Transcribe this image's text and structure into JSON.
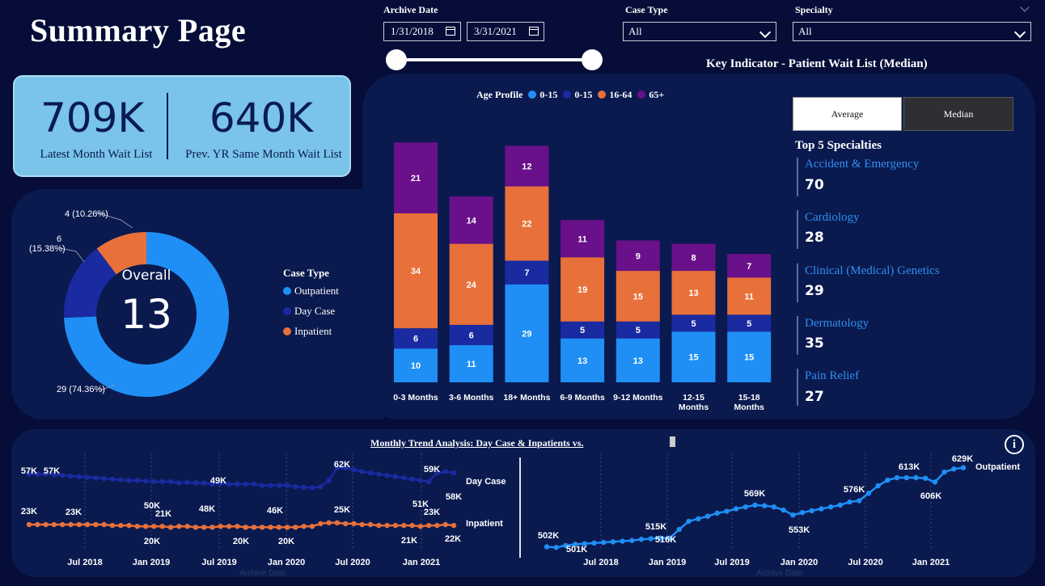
{
  "header": {
    "title": "Summary Page"
  },
  "filters": {
    "archive_date_label": "Archive Date",
    "start_date": "1/31/2018",
    "end_date": "3/31/2021",
    "slider_start": 0.0,
    "slider_end": 1.0,
    "case_type_label": "Case Type",
    "case_type_value": "All",
    "specialty_label": "Specialty",
    "specialty_value": "All"
  },
  "kpi": {
    "latest_value": "709K",
    "latest_label": "Latest Month Wait List",
    "prev_value": "640K",
    "prev_label": "Prev. YR Same Month Wait List"
  },
  "key_indicator": {
    "title": "Key Indicator - Patient Wait List (Median)"
  },
  "donut": {
    "center_label": "Overall",
    "center_value": "13",
    "legend_title": "Case Type",
    "legend": [
      "Outpatient",
      "Day Case",
      "Inpatient"
    ],
    "labels": {
      "outpatient": "29 (74.36%)",
      "daycase_value": "6",
      "daycase_pct": "(15.38%)",
      "inpatient": "4 (10.26%)"
    }
  },
  "age_profile": {
    "title": "Age Profile",
    "legend": [
      "0-15",
      "0-15",
      "16-64",
      "65+"
    ]
  },
  "toggle": {
    "average": "Average",
    "median": "Median"
  },
  "top_specialties": {
    "title": "Top 5 Specialties",
    "items": [
      {
        "name": "Accident & Emergency",
        "value": "70"
      },
      {
        "name": "Cardiology",
        "value": "28"
      },
      {
        "name": "Clinical (Medical) Genetics",
        "value": "29"
      },
      {
        "name": "Dermatology",
        "value": "35"
      },
      {
        "name": "Pain Relief",
        "value": "27"
      }
    ]
  },
  "trend": {
    "title": "Monthly Trend Analysis: Day Case & Inpatients vs.",
    "axis_title": "Archive Date",
    "x_ticks": [
      "Jul 2018",
      "Jan 2019",
      "Jul 2019",
      "Jan 2020",
      "Jul 2020",
      "Jan 2021"
    ],
    "right_x_ticks": [
      "Jul 2018",
      "Jan 2019",
      "Jul 2019",
      "Jan 2020",
      "Jul 2020",
      "Jan 2021"
    ]
  },
  "colors": {
    "outpatient": "#1f8ff5",
    "day_case": "#1a2aa0",
    "inpatient": "#e8703a",
    "age_65": "#6a108a",
    "background": "#050d38",
    "panel": "#0a1a4f"
  },
  "chart_data": [
    {
      "type": "pie",
      "title": "",
      "categories": [
        "Outpatient",
        "Day Case",
        "Inpatient"
      ],
      "values": [
        29,
        6,
        4
      ],
      "labels": [
        "29 (74.36%)",
        "6 (15.38%)",
        "4 (10.26%)"
      ]
    },
    {
      "type": "bar",
      "title": "Age Profile",
      "stacked": true,
      "categories": [
        "0-3 Months",
        "3-6 Months",
        "18+ Months",
        "6-9 Months",
        "9-12 Months",
        "12-15 Months",
        "15-18 Months"
      ],
      "series": [
        {
          "name": "0-15",
          "values": [
            10,
            11,
            29,
            13,
            13,
            15,
            15
          ]
        },
        {
          "name": "0-15",
          "values": [
            6,
            6,
            7,
            5,
            5,
            5,
            5
          ]
        },
        {
          "name": "16-64",
          "values": [
            34,
            24,
            22,
            19,
            15,
            13,
            11
          ]
        },
        {
          "name": "65+",
          "values": [
            21,
            14,
            12,
            11,
            9,
            8,
            7
          ]
        }
      ]
    },
    {
      "type": "line",
      "title": "Monthly Trend Analysis: Day Case & Inpatients vs.",
      "xlabel": "Archive Date",
      "x_ticks": [
        "Jul 2018",
        "Jan 2019",
        "Jul 2019",
        "Jan 2020",
        "Jul 2020",
        "Jan 2021"
      ],
      "series": [
        {
          "name": "Day Case",
          "values": [
            57,
            57,
            57,
            56.5,
            56,
            55.5,
            55,
            54.5,
            54,
            53.5,
            53,
            52.5,
            52,
            52,
            51.5,
            51,
            51,
            51,
            50,
            50.5,
            50,
            50,
            49,
            49.5,
            49,
            49,
            49,
            49,
            48,
            48,
            48,
            48,
            47,
            46.5,
            46,
            47,
            52,
            62,
            62,
            60.5,
            59,
            58,
            57,
            56,
            55,
            54,
            53,
            52,
            51,
            58,
            59,
            58
          ],
          "labels": [
            "57K",
            "57K",
            "50K",
            "49K",
            "46K",
            "62K",
            "59K",
            "58K",
            "51K"
          ]
        },
        {
          "name": "Inpatient",
          "values": [
            23,
            23,
            23,
            23,
            23,
            23,
            23,
            23,
            23,
            23,
            22,
            22,
            22,
            21,
            21,
            21,
            21,
            20,
            21,
            21,
            20,
            20,
            20,
            21,
            21,
            21,
            20,
            20,
            20,
            20,
            20,
            20,
            20,
            21,
            21,
            24,
            25,
            25,
            24,
            24,
            23,
            23,
            22,
            22,
            22,
            22,
            22,
            21,
            22,
            22,
            23,
            22
          ],
          "labels": [
            "23K",
            "23K",
            "21K",
            "20K",
            "48K",
            "20K",
            "20K",
            "25K",
            "23K",
            "21K",
            "22K"
          ]
        }
      ]
    },
    {
      "type": "line",
      "title": "",
      "xlabel": "Archive Date",
      "x_ticks": [
        "Jul 2018",
        "Jan 2019",
        "Jul 2019",
        "Jan 2020",
        "Jul 2020",
        "Jan 2021"
      ],
      "series": [
        {
          "name": "Outpatient",
          "values": [
            502,
            501,
            504,
            506,
            507,
            508,
            509,
            510,
            511,
            512,
            514,
            515,
            516,
            516,
            530,
            543,
            547,
            551,
            556,
            559,
            563,
            566,
            569,
            568,
            566,
            561,
            553,
            557,
            560,
            563,
            566,
            569,
            574,
            576,
            588,
            600,
            609,
            613,
            613,
            613,
            612,
            606,
            622,
            627,
            629
          ],
          "labels": [
            "502K",
            "501K",
            "515K",
            "516K",
            "569K",
            "553K",
            "576K",
            "613K",
            "606K",
            "629K"
          ]
        }
      ]
    }
  ]
}
